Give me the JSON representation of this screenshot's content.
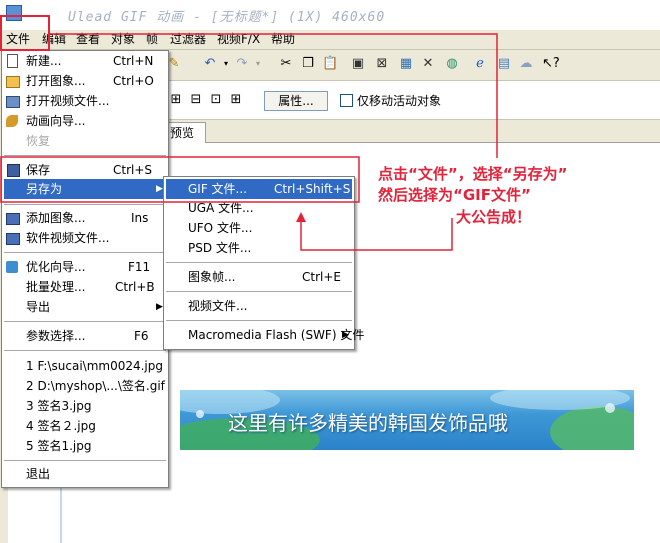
{
  "window": {
    "title": "Ulead GIF 动画 - [无标题*] (1X) 460x60"
  },
  "menubar": [
    {
      "label": "文件"
    },
    {
      "label": "编辑"
    },
    {
      "label": "查看"
    },
    {
      "label": "对象"
    },
    {
      "label": "帧"
    },
    {
      "label": "过滤器"
    },
    {
      "label": "视频F/X"
    },
    {
      "label": "帮助"
    }
  ],
  "toolbar2": {
    "props_button": "属性...",
    "checkbox_label": "仅移动活动对象"
  },
  "tabs": {
    "preview": "预览"
  },
  "file_menu": {
    "items": [
      {
        "label": "新建...",
        "shortcut": "Ctrl+N",
        "icon": "new-file-icon"
      },
      {
        "label": "打开图象...",
        "shortcut": "Ctrl+O",
        "icon": "open-image-icon"
      },
      {
        "label": "打开视频文件...",
        "shortcut": "",
        "icon": "open-video-icon"
      },
      {
        "label": "动画向导...",
        "shortcut": "",
        "icon": "wizard-icon"
      },
      {
        "label": "恢复",
        "shortcut": "",
        "icon": ""
      },
      {
        "label": "保存",
        "shortcut": "Ctrl+S",
        "icon": "save-icon"
      },
      {
        "label": "另存为",
        "shortcut": "",
        "icon": ""
      },
      {
        "label": "添加图象...",
        "shortcut": "Ins",
        "icon": "add-image-icon"
      },
      {
        "label": "软件视频文件...",
        "shortcut": "",
        "icon": "video-file-icon"
      },
      {
        "label": "优化向导...",
        "shortcut": "F11",
        "icon": "optimize-icon"
      },
      {
        "label": "批量处理...",
        "shortcut": "Ctrl+B",
        "icon": ""
      },
      {
        "label": "导出",
        "shortcut": "",
        "icon": ""
      },
      {
        "label": "参数选择...",
        "shortcut": "F6",
        "icon": ""
      },
      {
        "label": "1 F:\\sucai\\mm0024.jpg",
        "shortcut": "",
        "icon": ""
      },
      {
        "label": "2 D:\\myshop\\...\\签名.gif",
        "shortcut": "",
        "icon": ""
      },
      {
        "label": "3 签名3.jpg",
        "shortcut": "",
        "icon": ""
      },
      {
        "label": "4 签名２.jpg",
        "shortcut": "",
        "icon": ""
      },
      {
        "label": "5 签名1.jpg",
        "shortcut": "",
        "icon": ""
      },
      {
        "label": "退出",
        "shortcut": "",
        "icon": ""
      }
    ]
  },
  "save_as_submenu": {
    "items": [
      {
        "label": "GIF 文件...",
        "shortcut": "Ctrl+Shift+S"
      },
      {
        "label": "UGA 文件...",
        "shortcut": ""
      },
      {
        "label": "UFO 文件...",
        "shortcut": ""
      },
      {
        "label": "PSD 文件...",
        "shortcut": ""
      },
      {
        "label": "图象帧...",
        "shortcut": "Ctrl+E"
      },
      {
        "label": "视频文件...",
        "shortcut": ""
      },
      {
        "label": "Macromedia Flash (SWF) 文件",
        "shortcut": ""
      }
    ]
  },
  "annotation": {
    "line1": "点击“文件”，选择“另存为”",
    "line2": "然后选择为“GIF文件”",
    "line3": "大公告成！"
  },
  "banner": {
    "text": "这里有许多精美的韩国发饰品哦"
  },
  "colors": {
    "menu_highlight": "#316ac5",
    "annotation_red": "#e2233a"
  }
}
